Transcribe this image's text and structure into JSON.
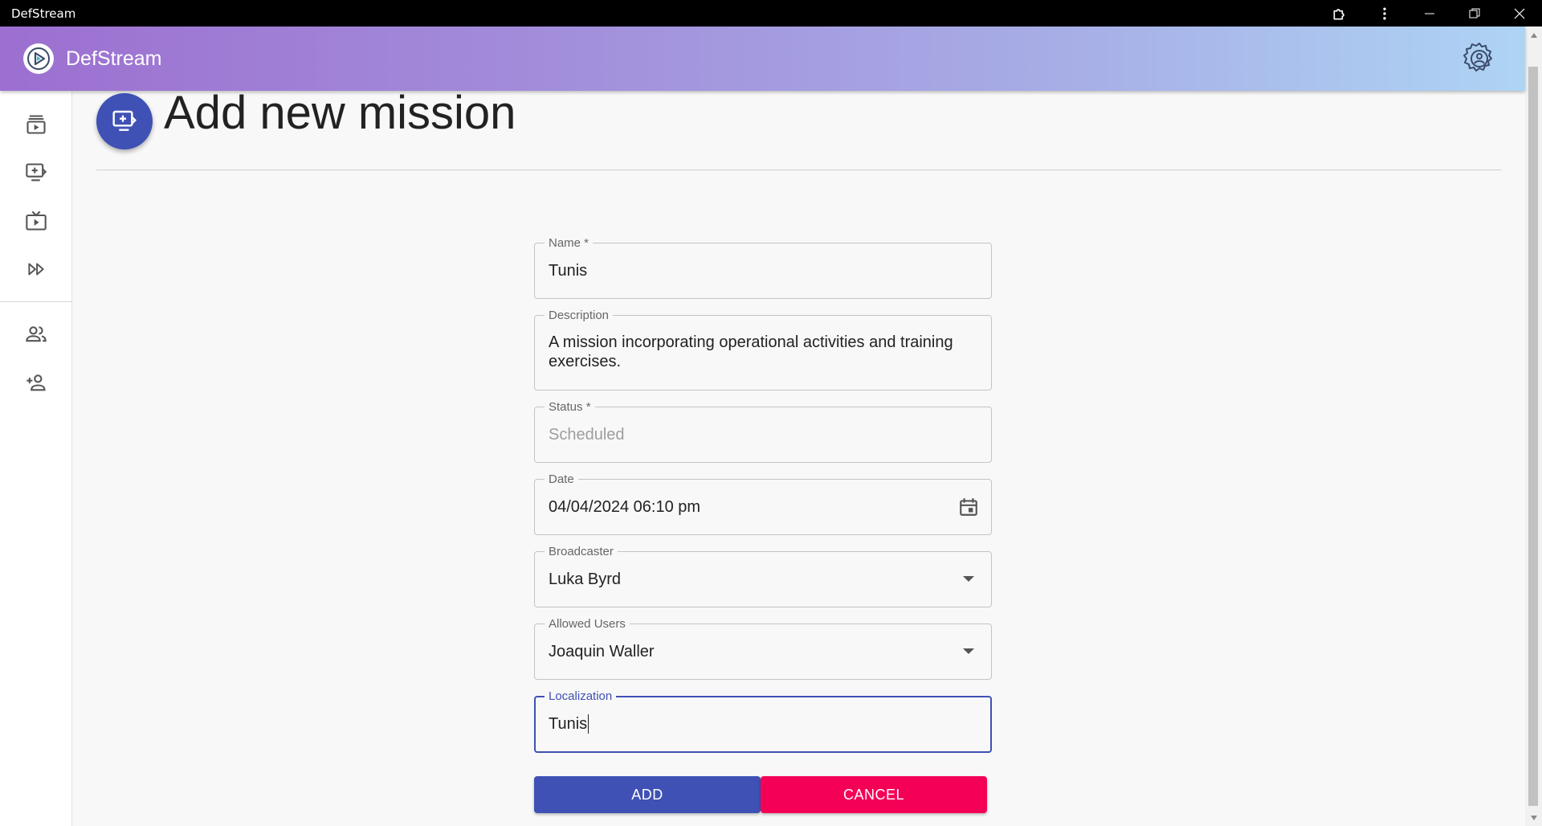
{
  "window": {
    "title": "DefStream"
  },
  "appbar": {
    "title": "DefStream"
  },
  "page": {
    "title": "Add new mission"
  },
  "form": {
    "name": {
      "label": "Name *",
      "value": "Tunis"
    },
    "description": {
      "label": "Description",
      "value": "A mission incorporating operational activities and training exercises."
    },
    "status": {
      "label": "Status *",
      "value": "Scheduled"
    },
    "date": {
      "label": "Date",
      "value": "04/04/2024 06:10 pm"
    },
    "broadcaster": {
      "label": "Broadcaster",
      "value": "Luka Byrd"
    },
    "allowed_users": {
      "label": "Allowed Users",
      "value": "Joaquin Waller"
    },
    "localization": {
      "label": "Localization",
      "value": "Tunis"
    }
  },
  "actions": {
    "add_label": "ADD",
    "cancel_label": "CANCEL"
  },
  "colors": {
    "primary": "#3f51b5",
    "secondary": "#f50057",
    "appbar_start": "#9c6fd0",
    "appbar_end": "#aed4f4"
  },
  "icons": {
    "sidebar": [
      "playlist-play-icon",
      "add-to-queue-icon",
      "live-tv-icon",
      "fast-forward-icon",
      "people-icon",
      "person-add-icon"
    ],
    "page": "add-to-queue-icon",
    "date": "calendar-icon",
    "select": "arrow-drop-down-icon",
    "settings": "gear-user-icon"
  }
}
